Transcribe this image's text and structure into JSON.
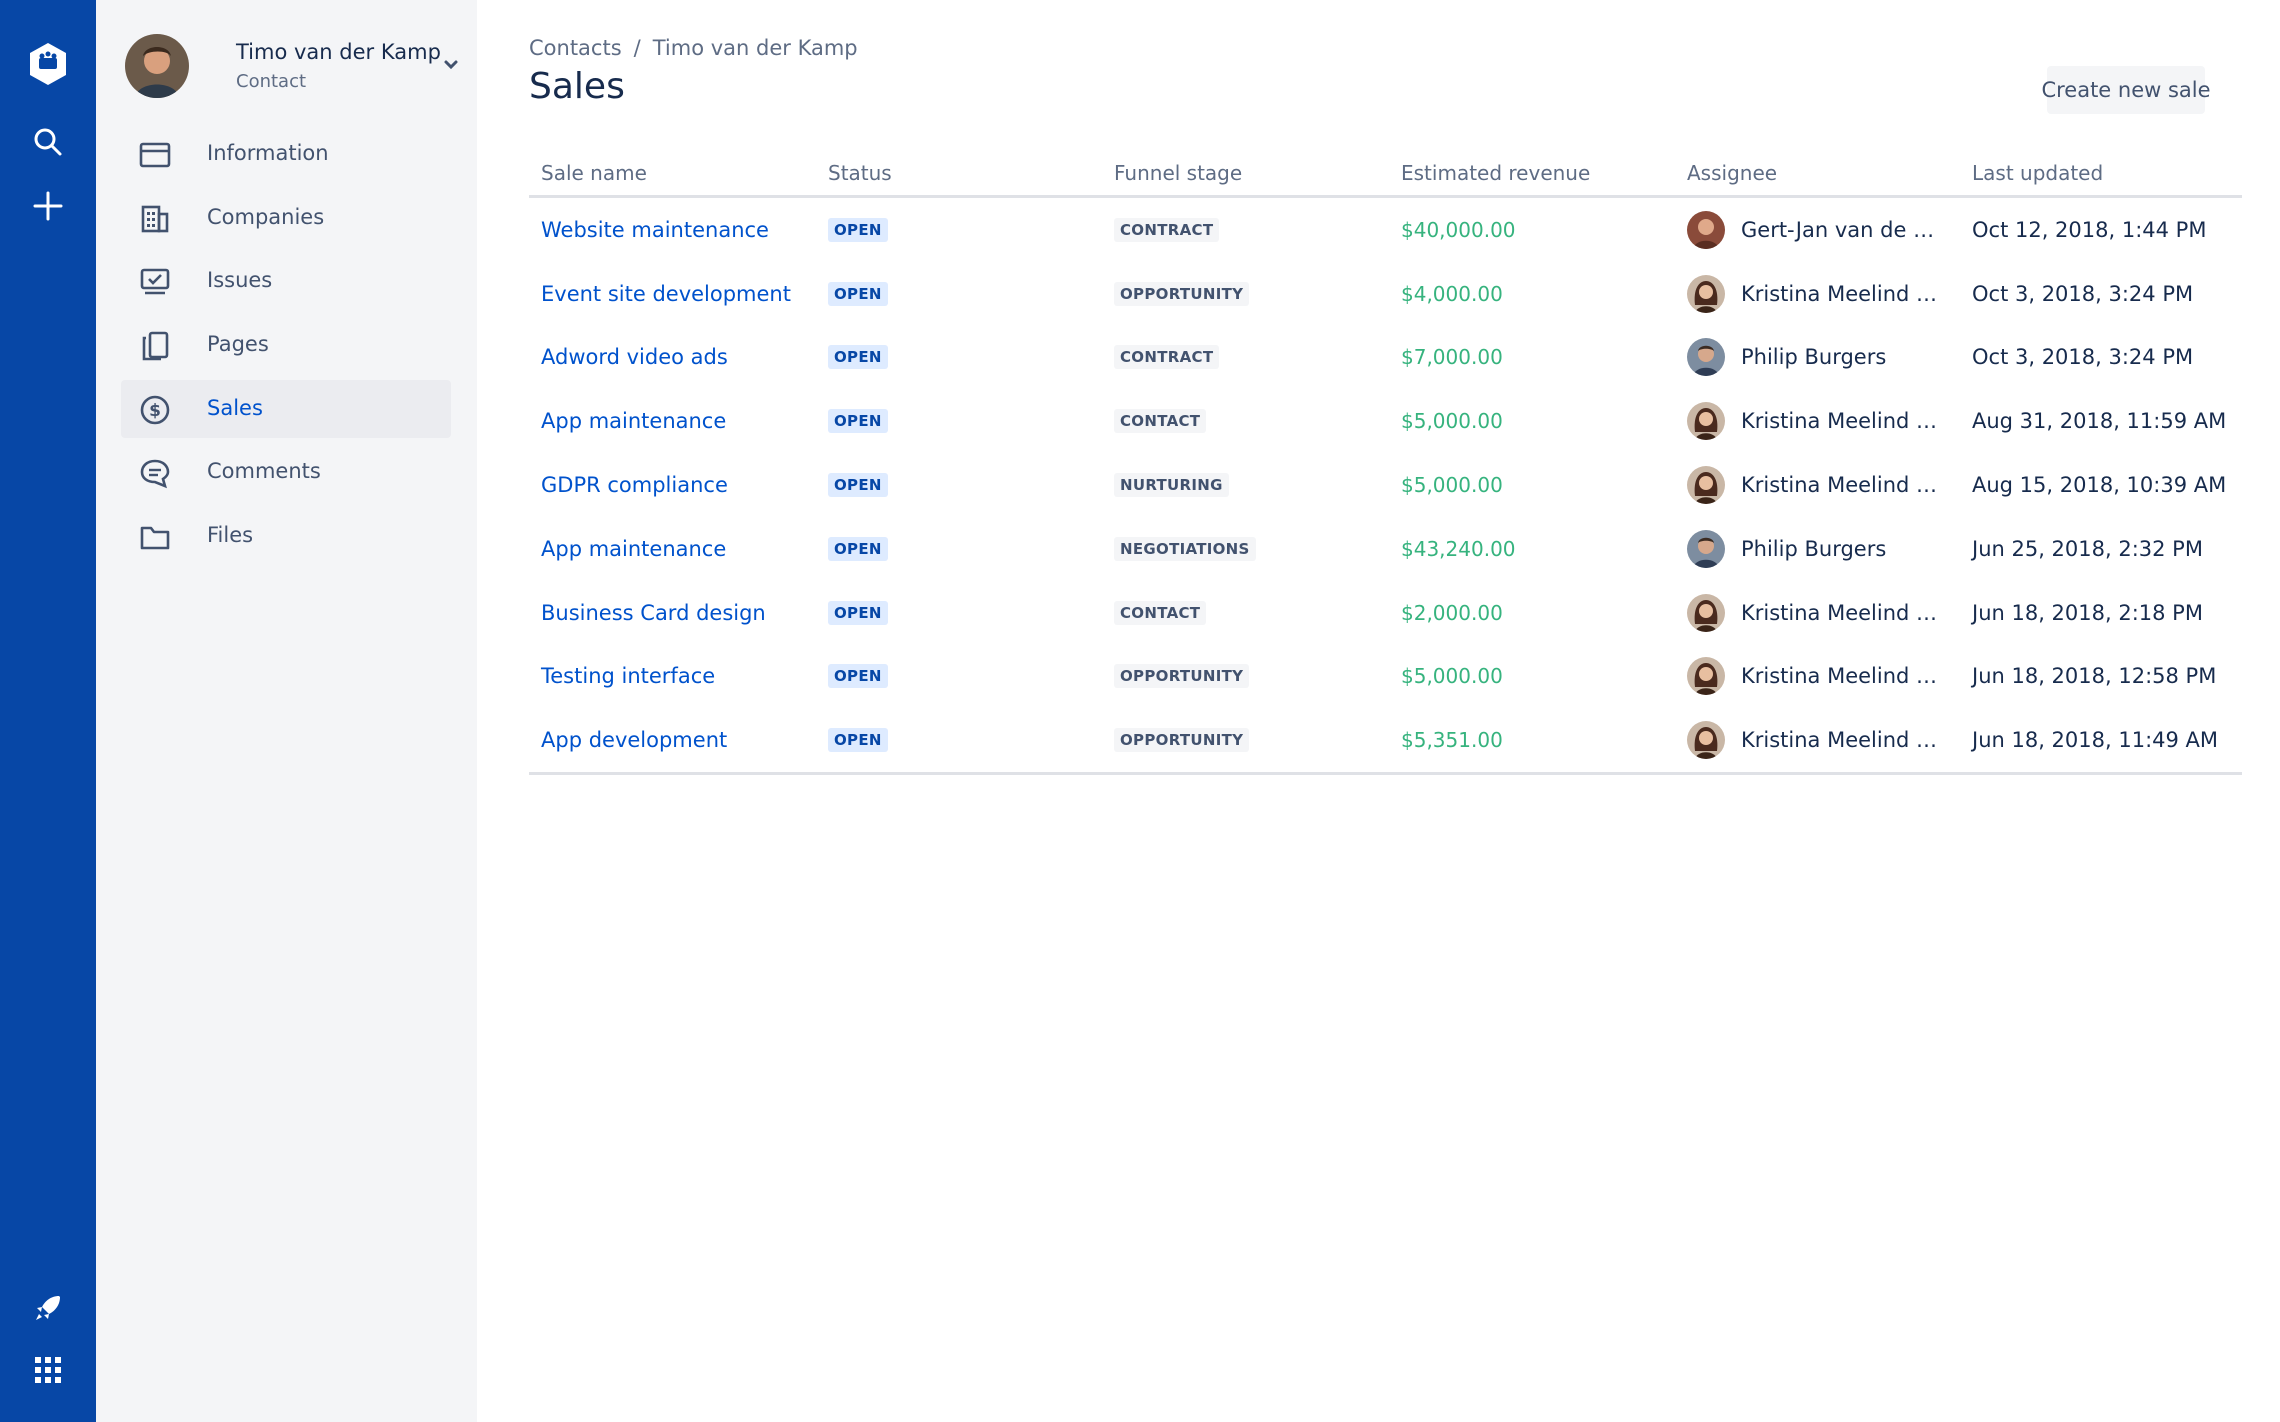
{
  "global_nav": {
    "icons": [
      "team-logo-icon",
      "search-icon",
      "plus-icon",
      "notification-rocket-icon",
      "app-switcher-icon"
    ],
    "brand_color": "#0747a6"
  },
  "sidebar": {
    "profile": {
      "name": "Timo van der Kamp",
      "subtitle": "Contact"
    },
    "items": [
      {
        "label": "Information",
        "icon": "card-icon",
        "active": false
      },
      {
        "label": "Companies",
        "icon": "building-icon",
        "active": false
      },
      {
        "label": "Issues",
        "icon": "issues-icon",
        "active": false
      },
      {
        "label": "Pages",
        "icon": "pages-icon",
        "active": false
      },
      {
        "label": "Sales",
        "icon": "dollar-icon",
        "active": true
      },
      {
        "label": "Comments",
        "icon": "comment-icon",
        "active": false
      },
      {
        "label": "Files",
        "icon": "folder-icon",
        "active": false
      }
    ]
  },
  "main": {
    "breadcrumb": {
      "root": "Contacts",
      "separator": "/",
      "current": "Timo van der Kamp"
    },
    "title": "Sales",
    "create_button": "Create new sale"
  },
  "table": {
    "columns": [
      "Sale name",
      "Status",
      "Funnel stage",
      "Estimated revenue",
      "Assignee",
      "Last updated"
    ],
    "rows": [
      {
        "name": "Website maintenance",
        "status": "OPEN",
        "stage": "CONTRACT",
        "revenue": "$40,000.00",
        "assignee": "Gert-Jan van de S...",
        "updated": "Oct 12, 2018, 1:44 PM"
      },
      {
        "name": "Event site development",
        "status": "OPEN",
        "stage": "OPPORTUNITY",
        "revenue": "$4,000.00",
        "assignee": "Kristina Meelind [...",
        "updated": "Oct 3, 2018, 3:24 PM"
      },
      {
        "name": "Adword video ads",
        "status": "OPEN",
        "stage": "CONTRACT",
        "revenue": "$7,000.00",
        "assignee": "Philip Burgers",
        "updated": "Oct 3, 2018, 3:24 PM"
      },
      {
        "name": "App maintenance",
        "status": "OPEN",
        "stage": "CONTACT",
        "revenue": "$5,000.00",
        "assignee": "Kristina Meelind [...",
        "updated": "Aug 31, 2018, 11:59 AM"
      },
      {
        "name": "GDPR compliance",
        "status": "OPEN",
        "stage": "NURTURING",
        "revenue": "$5,000.00",
        "assignee": "Kristina Meelind [...",
        "updated": "Aug 15, 2018, 10:39 AM"
      },
      {
        "name": "App maintenance",
        "status": "OPEN",
        "stage": "NEGOTIATIONS",
        "revenue": "$43,240.00",
        "assignee": "Philip Burgers",
        "updated": "Jun 25, 2018, 2:32 PM"
      },
      {
        "name": "Business Card design",
        "status": "OPEN",
        "stage": "CONTACT",
        "revenue": "$2,000.00",
        "assignee": "Kristina Meelind [...",
        "updated": "Jun 18, 2018, 2:18 PM"
      },
      {
        "name": "Testing interface",
        "status": "OPEN",
        "stage": "OPPORTUNITY",
        "revenue": "$5,000.00",
        "assignee": "Kristina Meelind [...",
        "updated": "Jun 18, 2018, 12:58 PM"
      },
      {
        "name": "App development",
        "status": "OPEN",
        "stage": "OPPORTUNITY",
        "revenue": "$5,351.00",
        "assignee": "Kristina Meelind [...",
        "updated": "Jun 18, 2018, 11:49 AM"
      }
    ]
  },
  "colors": {
    "link": "#0052cc",
    "revenue": "#36b37e",
    "open_lozenge_bg": "#deebff",
    "open_lozenge_text": "#0747a6"
  }
}
